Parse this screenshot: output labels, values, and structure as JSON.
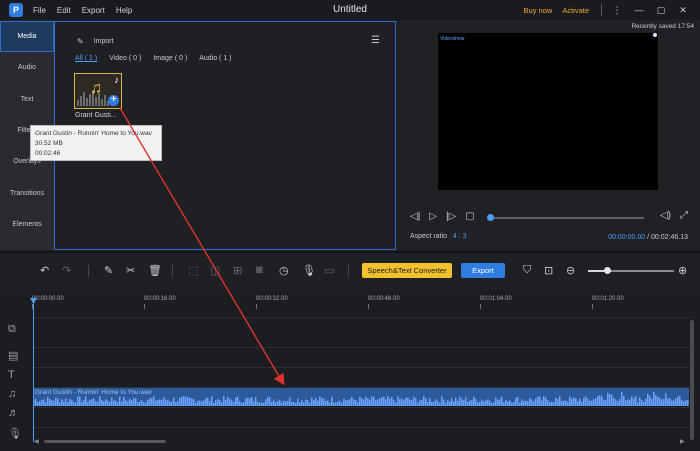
{
  "titlebar": {
    "app_logo": "P",
    "menu": [
      "File",
      "Edit",
      "Export",
      "Help"
    ],
    "title": "Untitled",
    "buy_now": "Buy now",
    "activate": "Activate"
  },
  "sidebar": {
    "tabs": [
      {
        "label": "Media",
        "active": true
      },
      {
        "label": "Audio"
      },
      {
        "label": "Text"
      },
      {
        "label": "Filters"
      },
      {
        "label": "Overlays"
      },
      {
        "label": "Transitions"
      },
      {
        "label": "Elements"
      }
    ]
  },
  "media": {
    "import_label": "Import",
    "filters": [
      "All ( 1 )",
      "Video ( 0 )",
      "Image ( 0 )",
      "Audio ( 1 )"
    ],
    "thumb_label": "Grant Gusti...",
    "tooltip": {
      "name": "Grant Gustin - Runnin' Home to You.wav",
      "size": "30.52 MB",
      "duration": "00:02:46"
    }
  },
  "preview": {
    "saved": "Recently saved 17:54",
    "watermark": "Videoshow",
    "aspect_label": "Aspect ratio",
    "aspect_value": "4 : 3",
    "current_time": "00:00:00.00",
    "total_time": "/ 00:02:46.13"
  },
  "toolbar": {
    "speech_button": "Speech&Text Converter",
    "export_button": "Export",
    "zoom_level": 0.22
  },
  "timeline": {
    "ruler": [
      "00:00:00.00",
      "00:00:16.00",
      "00:00:32.00",
      "00:00:48.00",
      "00:01:04.00",
      "00:01:20.00"
    ],
    "clip_name": "Grant Gustin - Runnin' Home to You.wav"
  },
  "colors": {
    "accent": "#2f7de1",
    "highlight": "#4f9cf5",
    "yellow": "#f2c12e",
    "arrow": "#e0322e"
  }
}
